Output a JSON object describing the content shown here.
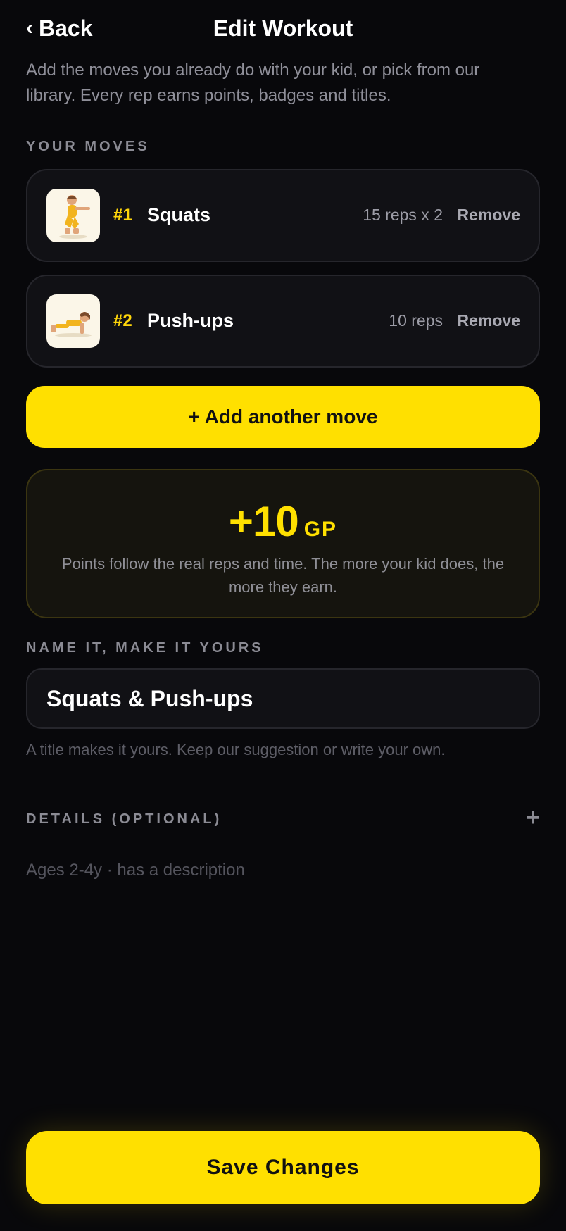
{
  "header": {
    "back_label": "Back",
    "title": "Edit Workout"
  },
  "intro": "Add the moves you already do with your kid, or pick from our library. Every rep earns points, badges and titles.",
  "moves_section": {
    "label": "YOUR MOVES",
    "items": [
      {
        "number": "#1",
        "name": "Squats",
        "reps": "15 reps x 2",
        "remove_label": "Remove",
        "icon": "squat-illustration-icon"
      },
      {
        "number": "#2",
        "name": "Push-ups",
        "reps": "10 reps",
        "remove_label": "Remove",
        "icon": "pushup-illustration-icon"
      }
    ]
  },
  "add_move_label": "+ Add another move",
  "points": {
    "value": "+10",
    "unit": "GP",
    "description": "Points follow the real reps and time. The more your kid does, the more they earn."
  },
  "name_section": {
    "label": "NAME IT, MAKE IT YOURS",
    "input_value": "Squats & Push-ups",
    "hint": "A title makes it yours. Keep our suggestion or write your own."
  },
  "details_section": {
    "label": "DETAILS (OPTIONAL)",
    "toggle_symbol": "+",
    "summary": "Ages 2-4y · has a description"
  },
  "save_label": "Save Changes",
  "colors": {
    "background": "#08080b",
    "accent": "#ffe000",
    "card": "#111115"
  }
}
